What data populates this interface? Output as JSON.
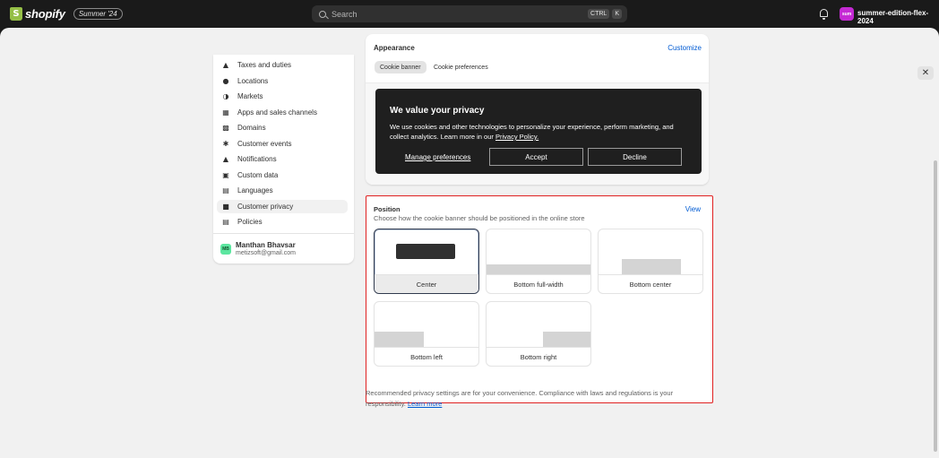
{
  "topbar": {
    "logo_text": "shopify",
    "edition_badge": "Summer '24",
    "search_placeholder": "Search",
    "shortcut_keys": [
      "CTRL",
      "K"
    ],
    "store_initials": "sum",
    "store_name": "summer-edition-flex-2024"
  },
  "sidebar": {
    "items": [
      {
        "label": "Taxes and duties",
        "icon": "tax-icon"
      },
      {
        "label": "Locations",
        "icon": "location-pin-icon"
      },
      {
        "label": "Markets",
        "icon": "globe-icon"
      },
      {
        "label": "Apps and sales channels",
        "icon": "apps-grid-icon"
      },
      {
        "label": "Domains",
        "icon": "domain-icon"
      },
      {
        "label": "Customer events",
        "icon": "sparkle-icon"
      },
      {
        "label": "Notifications",
        "icon": "bell-icon"
      },
      {
        "label": "Custom data",
        "icon": "database-icon"
      },
      {
        "label": "Languages",
        "icon": "languages-icon"
      },
      {
        "label": "Customer privacy",
        "icon": "lock-icon",
        "active": true
      },
      {
        "label": "Policies",
        "icon": "policies-icon"
      }
    ],
    "user": {
      "initials": "MB",
      "name": "Manthan Bhavsar",
      "email": "metizsoft@gmail.com"
    }
  },
  "appearance": {
    "title": "Appearance",
    "customize_link": "Customize",
    "tabs": [
      {
        "label": "Cookie banner",
        "active": true
      },
      {
        "label": "Cookie preferences",
        "active": false
      }
    ],
    "banner": {
      "title": "We value your privacy",
      "body": "We use cookies and other technologies to personalize your experience, perform marketing, and collect analytics. Learn more in our ",
      "policy_link": "Privacy Policy.",
      "manage_label": "Manage preferences",
      "accept_label": "Accept",
      "decline_label": "Decline"
    }
  },
  "position": {
    "title": "Position",
    "subtitle": "Choose how the cookie banner should be positioned in the online store",
    "view_link": "View",
    "options": [
      {
        "label": "Center",
        "selected": true
      },
      {
        "label": "Bottom full-width",
        "selected": false
      },
      {
        "label": "Bottom center",
        "selected": false
      },
      {
        "label": "Bottom left",
        "selected": false
      },
      {
        "label": "Bottom right",
        "selected": false
      }
    ]
  },
  "footer": {
    "note": "Recommended privacy settings are for your convenience. Compliance with laws and regulations is your responsibility. ",
    "learn_more": "Learn more"
  },
  "colors": {
    "brand_green": "#95bf47",
    "link_blue": "#005bd3",
    "highlight_red": "#e02020",
    "banner_dark": "#1f1f1f"
  }
}
